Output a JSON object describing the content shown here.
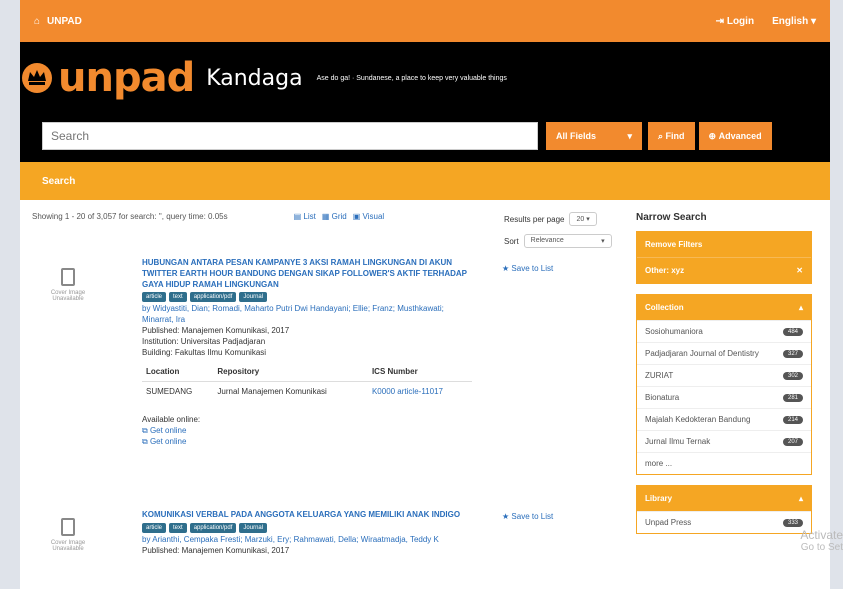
{
  "topbar": {
    "home_label": "UNPAD",
    "login_label": "Login",
    "language_label": "English"
  },
  "header": {
    "logo_text": "unpad",
    "app_name": "Kandaga",
    "tagline": "Ase do ga! · Sundanese, a place to keep very valuable things"
  },
  "search": {
    "placeholder": "Search",
    "type_label": "All Fields",
    "find_label": "Find",
    "advanced_label": "Advanced"
  },
  "breadcrumb": {
    "label": "Search"
  },
  "results": {
    "summary": "Showing 1 - 20 of 3,057 for search: '', query time: 0.05s",
    "views": {
      "list": "List",
      "grid": "Grid",
      "visual": "Visual"
    },
    "rpp_label": "Results per page",
    "rpp_value": "20",
    "sort_label": "Sort",
    "sort_value": "Relevance",
    "records": [
      {
        "title": "HUBUNGAN ANTARA PESAN KAMPANYE 3 AKSI RAMAH LINGKUNGAN DI AKUN TWITTER EARTH HOUR BANDUNG DENGAN SIKAP FOLLOWER'S AKTIF TERHADAP GAYA HIDUP RAMAH LINGKUNGAN",
        "tags": [
          "article",
          "text",
          "application/pdf",
          "Journal"
        ],
        "authors": "by Widyastiti, Dian; Romadi, Maharto Putri Dwi Handayani; Ellie; Franz; Musthkawati; Minarrat, Ira",
        "published": "Published: Manajemen Komunikasi, 2017",
        "institution": "Institution: Universitas Padjadjaran",
        "building": "Building: Fakultas Ilmu Komunikasi",
        "holdings": {
          "h_location": "Location",
          "h_repository": "Repository",
          "h_ics": "ICS Number",
          "location": "SUMEDANG",
          "repository": "Jurnal Manajemen Komunikasi",
          "ics": "K0000 article-11017"
        },
        "available": "Available online:",
        "links": [
          "Get online",
          "Get online"
        ],
        "save": "Save to List"
      },
      {
        "title": "KOMUNIKASI VERBAL PADA ANGGOTA KELUARGA YANG MEMILIKI ANAK INDIGO",
        "tags": [
          "article",
          "text",
          "application/pdf",
          "Journal"
        ],
        "authors": "by Arianthi, Cempaka Fresti; Marzuki, Ery; Rahmawati, Della; Wiraatmadja, Teddy K",
        "published": "Published: Manajemen Komunikasi, 2017",
        "save": "Save to List"
      }
    ],
    "thumb_text": "Cover Image Unavailable"
  },
  "sidebar": {
    "heading": "Narrow Search",
    "remove_filters": {
      "title": "Remove Filters",
      "item": "Other: xyz"
    },
    "collection": {
      "title": "Collection",
      "items": [
        {
          "label": "Sosiohumaniora",
          "count": "484"
        },
        {
          "label": "Padjadjaran Journal of Dentistry",
          "count": "327"
        },
        {
          "label": "ZURIAT",
          "count": "302"
        },
        {
          "label": "Bionatura",
          "count": "281"
        },
        {
          "label": "Majalah Kedokteran Bandung",
          "count": "214"
        },
        {
          "label": "Jurnal Ilmu Ternak",
          "count": "207"
        }
      ],
      "more": "more ..."
    },
    "library": {
      "title": "Library",
      "first_item": "Unpad Press",
      "first_count": "333"
    }
  },
  "watermark": {
    "line1": "Activate",
    "line2": "Go to Set"
  },
  "colors": {
    "topbar": "#f28a2e",
    "header": "#000000",
    "accent": "#f5a623",
    "link": "#2a6ebb",
    "tag": "#2f6e8c"
  }
}
